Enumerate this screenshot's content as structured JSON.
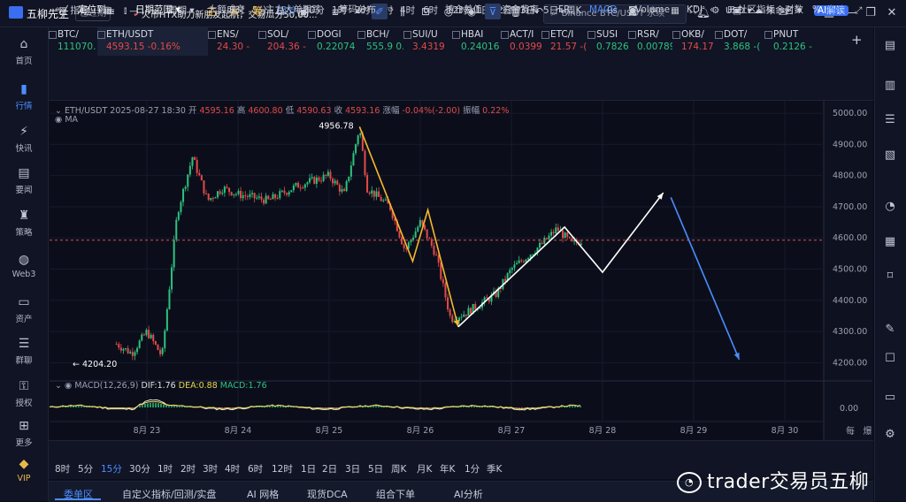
{
  "app": {
    "name": "五柳先生",
    "expired_label": "已过期"
  },
  "news_ticker": "火币HTX助力新朋友起航，交易瓜分50,00...",
  "search": {
    "placeholder": "Binance BTC/USDT 永续"
  },
  "currency": "USD",
  "left_nav": [
    {
      "label": "首页",
      "icon": "home-icon"
    },
    {
      "label": "行情",
      "icon": "market-chart-icon",
      "active": true
    },
    {
      "label": "快讯",
      "icon": "flash-news-icon"
    },
    {
      "label": "要闻",
      "icon": "news-icon"
    },
    {
      "label": "策略",
      "icon": "strategy-icon"
    },
    {
      "label": "Web3",
      "icon": "web3-icon"
    },
    {
      "label": "资产",
      "icon": "wallet-icon"
    },
    {
      "label": "群聊",
      "icon": "chat-icon"
    },
    {
      "label": "授权",
      "icon": "key-icon"
    },
    {
      "label": "更多",
      "icon": "more-icon"
    },
    {
      "label": "VIP",
      "icon": "vip-diamond-icon"
    }
  ],
  "tickers": [
    {
      "name": "BTC/",
      "price": "111070.",
      "dir": "up"
    },
    {
      "name": "ETH/USDT",
      "price": "4593.15",
      "change": "-0.16%",
      "dir": "dn",
      "active": true
    },
    {
      "name": "ENS/",
      "price": "24.30",
      "change": "-",
      "dir": "dn"
    },
    {
      "name": "SOL/",
      "price": "204.36",
      "change": "-",
      "dir": "dn"
    },
    {
      "name": "DOGI",
      "price": "0.22074",
      "dir": "up"
    },
    {
      "name": "BCH/",
      "price": "555.9",
      "change": "0.",
      "dir": "up"
    },
    {
      "name": "SUI/U",
      "price": "3.4319",
      "dir": "dn"
    },
    {
      "name": "HBAI",
      "price": "0.24016",
      "dir": "up"
    },
    {
      "name": "ACT/I",
      "price": "0.0399",
      "change": "-",
      "dir": "dn"
    },
    {
      "name": "ETC/I",
      "price": "21.57",
      "change": "-(",
      "dir": "dn"
    },
    {
      "name": "SUSI",
      "price": "0.7826",
      "change": "-",
      "dir": "up"
    },
    {
      "name": "RSR/",
      "price": "0.00789",
      "dir": "up"
    },
    {
      "name": "OKB/",
      "price": "174.17",
      "change": "-",
      "dir": "dn"
    },
    {
      "name": "DOT/",
      "price": "3.868",
      "change": "-(",
      "dir": "up"
    },
    {
      "name": "PNUT",
      "price": "0.2126",
      "change": "-",
      "dir": "up"
    }
  ],
  "toolbar1": {
    "indicators": "指标",
    "period": "周期",
    "intervals": [
      "8时",
      "5分",
      "15分",
      "30分",
      "1时",
      "2时",
      "3时",
      "4时",
      "6时",
      "12时",
      "1日",
      "2日",
      "3日",
      "5日",
      "周K"
    ],
    "selected_interval": "15分",
    "countdown": "0s",
    "unnamed": "未命名",
    "ai_label": "AI解读"
  },
  "drawing_tools": [
    "主",
    "大",
    "筹"
  ],
  "legend": {
    "symbol": "ETH/USDT",
    "datetime": "2025-08-27 18:30",
    "open_label": "开",
    "open": "4595.16",
    "high_label": "高",
    "high": "4600.80",
    "low_label": "低",
    "low": "4590.63",
    "close_label": "收",
    "close": "4593.16",
    "change_label": "涨幅",
    "change": "-0.04%(-2.00)",
    "amp_label": "振幅",
    "amp": "0.22%",
    "ma": "MA"
  },
  "macd": {
    "name": "MACD(12,26,9)",
    "dif_label": "DIF:",
    "dif": "1.76",
    "dea_label": "DEA:",
    "dea": "0.88",
    "macd_label": "MACD:",
    "macd_value": "1.76"
  },
  "chart_data": {
    "type": "candlestick",
    "symbol": "ETH/USDT",
    "interval": "15m",
    "y_ticks": [
      5000,
      4900,
      4800,
      4700,
      4600,
      4500,
      4400,
      4300,
      4200
    ],
    "ylim": [
      4150,
      5040
    ],
    "x_ticks": [
      "8月 23",
      "8月 24",
      "8月 25",
      "8月 26",
      "8月 27",
      "8月 28",
      "8月 29",
      "8月 30"
    ],
    "macd_axis_label": "0.00",
    "current_price_line": 4593,
    "annotations": {
      "high_label": "4956.78",
      "low_label": "4204.20"
    },
    "price_path": [
      {
        "x": "8月 22 16:00",
        "y": 4260
      },
      {
        "x": "8月 22 20:00",
        "y": 4230
      },
      {
        "x": "8月 23 00:00",
        "y": 4300
      },
      {
        "x": "8月 23 04:00",
        "y": 4220
      },
      {
        "x": "8月 23 08:00",
        "y": 4680
      },
      {
        "x": "8月 23 12:00",
        "y": 4860
      },
      {
        "x": "8月 23 16:00",
        "y": 4720
      },
      {
        "x": "8月 23 20:00",
        "y": 4760
      },
      {
        "x": "8月 24 00:00",
        "y": 4740
      },
      {
        "x": "8月 24 08:00",
        "y": 4720
      },
      {
        "x": "8月 24 16:00",
        "y": 4770
      },
      {
        "x": "8月 25 00:00",
        "y": 4800
      },
      {
        "x": "8月 25 04:00",
        "y": 4740
      },
      {
        "x": "8月 25 08:00",
        "y": 4955
      },
      {
        "x": "8月 25 10:00",
        "y": 4760
      },
      {
        "x": "8月 25 16:00",
        "y": 4700
      },
      {
        "x": "8月 25 20:00",
        "y": 4560
      },
      {
        "x": "8月 26 00:00",
        "y": 4650
      },
      {
        "x": "8月 26 04:00",
        "y": 4550
      },
      {
        "x": "8月 26 08:00",
        "y": 4340
      },
      {
        "x": "8月 26 12:00",
        "y": 4360
      },
      {
        "x": "8月 26 20:00",
        "y": 4420
      },
      {
        "x": "8月 27 00:00",
        "y": 4500
      },
      {
        "x": "8月 27 08:00",
        "y": 4580
      },
      {
        "x": "8月 27 12:00",
        "y": 4630
      },
      {
        "x": "8月 27 16:00",
        "y": 4580
      },
      {
        "x": "8月 27 18:30",
        "y": 4593
      }
    ],
    "drawings": [
      {
        "color": "#f5b82e",
        "points": [
          {
            "x": "8月 25 08:00",
            "y": 4957
          },
          {
            "x": "8月 25 22:00",
            "y": 4525
          },
          {
            "x": "8月 26 02:00",
            "y": 4690
          },
          {
            "x": "8月 26 10:00",
            "y": 4315
          }
        ]
      },
      {
        "color": "#ffffff",
        "points": [
          {
            "x": "8月 26 10:00",
            "y": 4315
          },
          {
            "x": "8月 27 14:00",
            "y": 4635
          },
          {
            "x": "8月 28 00:00",
            "y": 4490
          },
          {
            "x": "8月 28 16:00",
            "y": 4745
          }
        ]
      },
      {
        "color": "#4c8dff",
        "points": [
          {
            "x": "8月 28 18:00",
            "y": 4730
          },
          {
            "x": "8月 29 12:00",
            "y": 4210
          }
        ]
      }
    ]
  },
  "bottom_bar1": {
    "locate": "定位到...",
    "date_range": "日期范围",
    "indicators": [
      "大额成交",
      "主力大单跟踪",
      "筹码分布",
      "持仓差值",
      "资金背离",
      "FR",
      "MACD",
      "Volume",
      "KDJ"
    ],
    "selected": "MACD",
    "community": "社区指标",
    "log": "对数",
    "pct": "%",
    "auto": "自动"
  },
  "bottom_bar2": {
    "intervals": [
      "8时",
      "5分",
      "15分",
      "30分",
      "1时",
      "2时",
      "3时",
      "4时",
      "6时",
      "12时",
      "1日",
      "2日",
      "3日",
      "5日",
      "周K",
      "月K",
      "年K",
      "1分",
      "季K"
    ],
    "selected": "15分"
  },
  "bottom_tabs": [
    "委单区",
    "自定义指标/回测/实盘",
    "AI 网格",
    "现货DCA",
    "组合下单",
    "AI分析"
  ],
  "axis_corner": [
    "每",
    "爆"
  ],
  "watermark": "trader交易员五柳"
}
